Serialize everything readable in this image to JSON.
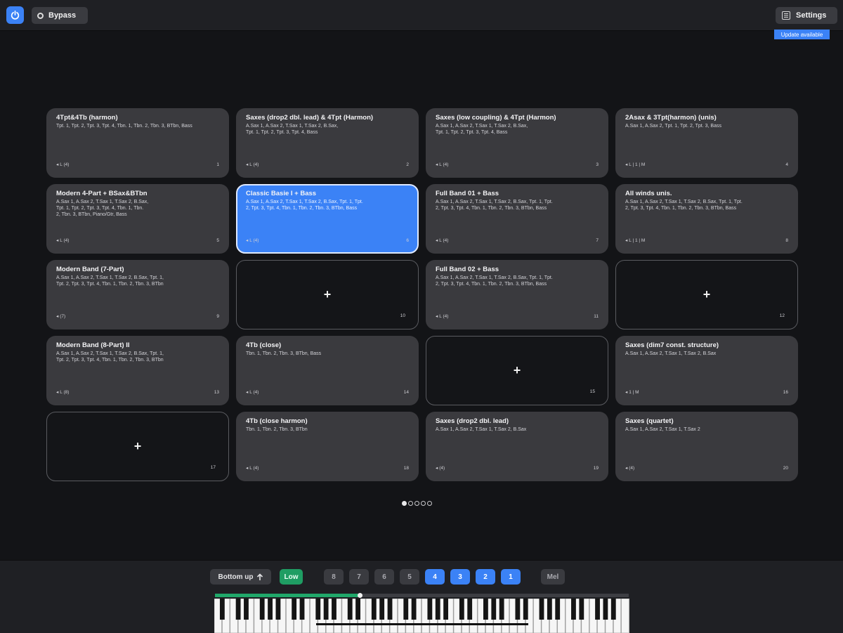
{
  "topbar": {
    "bypass_label": "Bypass",
    "settings_label": "Settings",
    "update_badge": "Update available",
    "accent_color": "#3b82f6"
  },
  "presets": [
    {
      "number": "1",
      "title": "4Tpt&4Tb (harmon)",
      "desc": "Tpt. 1, Tpt. 2, Tpt. 3, Tpt. 4, Tbn. 1, Tbn. 2, Tbn. 3, BTbn, Bass",
      "meta": "L (4)",
      "state": "filled"
    },
    {
      "number": "2",
      "title": "Saxes (drop2 dbl. lead) & 4Tpt (Harmon)",
      "desc": "A.Sax 1, A.Sax 2, T.Sax 1, T.Sax 2, B.Sax,\nTpt. 1, Tpt. 2, Tpt. 3, Tpt. 4, Bass",
      "meta": "L (4)",
      "state": "filled"
    },
    {
      "number": "3",
      "title": "Saxes (low coupling) & 4Tpt (Harmon)",
      "desc": "A.Sax 1, A.Sax 2, T.Sax 1, T.Sax 2, B.Sax,\nTpt. 1, Tpt. 2, Tpt. 3, Tpt. 4, Bass",
      "meta": "L (4)",
      "state": "filled"
    },
    {
      "number": "4",
      "title": "2Asax & 3Tpt(harmon) (unis)",
      "desc": "A.Sax 1, A.Sax 2, Tpt. 1, Tpt. 2, Tpt. 3, Bass",
      "meta": "L | 1 | M",
      "state": "filled"
    },
    {
      "number": "5",
      "title": "Modern 4-Part + BSax&BTbn",
      "desc": "A.Sax 1, A.Sax 2, T.Sax 1, T.Sax 2, B.Sax,\nTpt. 1, Tpt. 2, Tpt. 3, Tpt. 4, Tbn. 1, Tbn.\n2, Tbn. 3, BTbn, Piano/Gtr, Bass",
      "meta": "L (4)",
      "state": "filled"
    },
    {
      "number": "6",
      "title": "Classic Basie I + Bass",
      "desc": "A.Sax 1, A.Sax 2, T.Sax 1, T.Sax 2, B.Sax, Tpt. 1, Tpt.\n2, Tpt. 3, Tpt. 4, Tbn. 1, Tbn. 2, Tbn. 3, BTbn, Bass",
      "meta": "L (4)",
      "state": "selected"
    },
    {
      "number": "7",
      "title": "Full Band 01 + Bass",
      "desc": "A.Sax 1, A.Sax 2, T.Sax 1, T.Sax 2, B.Sax, Tpt. 1, Tpt.\n2, Tpt. 3, Tpt. 4, Tbn. 1, Tbn. 2, Tbn. 3, BTbn, Bass",
      "meta": "L (4)",
      "state": "filled"
    },
    {
      "number": "8",
      "title": "All winds unis.",
      "desc": "A.Sax 1, A.Sax 2, T.Sax 1, T.Sax 2, B.Sax, Tpt. 1, Tpt.\n2, Tpt. 3, Tpt. 4, Tbn. 1, Tbn. 2, Tbn. 3, BTbn, Bass",
      "meta": "L | 1 | M",
      "state": "filled"
    },
    {
      "number": "9",
      "title": "Modern Band (7-Part)",
      "desc": "A.Sax 1, A.Sax 2, T.Sax 1, T.Sax 2, B.Sax, Tpt. 1,\nTpt. 2, Tpt. 3, Tpt. 4, Tbn. 1, Tbn. 2, Tbn. 3, BTbn",
      "meta": "(7)",
      "state": "filled"
    },
    {
      "number": "10",
      "title": "",
      "desc": "",
      "meta": "",
      "state": "empty"
    },
    {
      "number": "11",
      "title": "Full Band 02 + Bass",
      "desc": "A.Sax 1, A.Sax 2, T.Sax 1, T.Sax 2, B.Sax, Tpt. 1, Tpt.\n2, Tpt. 3, Tpt. 4, Tbn. 1, Tbn. 2, Tbn. 3, BTbn, Bass",
      "meta": "L (4)",
      "state": "filled"
    },
    {
      "number": "12",
      "title": "",
      "desc": "",
      "meta": "",
      "state": "empty"
    },
    {
      "number": "13",
      "title": "Modern Band (8-Part) II",
      "desc": "A.Sax 1, A.Sax 2, T.Sax 1, T.Sax 2, B.Sax, Tpt. 1,\nTpt. 2, Tpt. 3, Tpt. 4, Tbn. 1, Tbn. 2, Tbn. 3, BTbn",
      "meta": "L (8)",
      "state": "filled"
    },
    {
      "number": "14",
      "title": "4Tb (close)",
      "desc": "Tbn. 1, Tbn. 2, Tbn. 3, BTbn, Bass",
      "meta": "L (4)",
      "state": "filled"
    },
    {
      "number": "15",
      "title": "",
      "desc": "",
      "meta": "",
      "state": "empty"
    },
    {
      "number": "16",
      "title": "Saxes (dim7 const. structure)",
      "desc": "A.Sax 1, A.Sax 2, T.Sax 1, T.Sax 2, B.Sax",
      "meta": "1 | M",
      "state": "filled"
    },
    {
      "number": "17",
      "title": "",
      "desc": "",
      "meta": "",
      "state": "empty"
    },
    {
      "number": "18",
      "title": "4Tb (close harmon)",
      "desc": "Tbn. 1, Tbn. 2, Tbn. 3, BTbn",
      "meta": "L (4)",
      "state": "filled"
    },
    {
      "number": "19",
      "title": "Saxes (drop2 dbl. lead)",
      "desc": "A.Sax 1, A.Sax 2, T.Sax 1, T.Sax 2, B.Sax",
      "meta": "(4)",
      "state": "filled"
    },
    {
      "number": "20",
      "title": "Saxes (quartet)",
      "desc": "A.Sax 1, A.Sax 2, T.Sax 1, T.Sax 2",
      "meta": "(4)",
      "state": "filled"
    }
  ],
  "empty_slot_symbol": "+",
  "pager": {
    "page_count": 5,
    "current_page": 1
  },
  "controls": {
    "voicing_label": "Bottom up",
    "range_label": "Low",
    "voices": [
      {
        "label": "8",
        "active": false
      },
      {
        "label": "7",
        "active": false
      },
      {
        "label": "6",
        "active": false
      },
      {
        "label": "5",
        "active": false
      },
      {
        "label": "4",
        "active": true
      },
      {
        "label": "3",
        "active": true
      },
      {
        "label": "2",
        "active": true
      },
      {
        "label": "1",
        "active": true
      }
    ],
    "mel_label": "Mel",
    "progress_fraction": 0.35,
    "progress_color": "#20a86a"
  }
}
